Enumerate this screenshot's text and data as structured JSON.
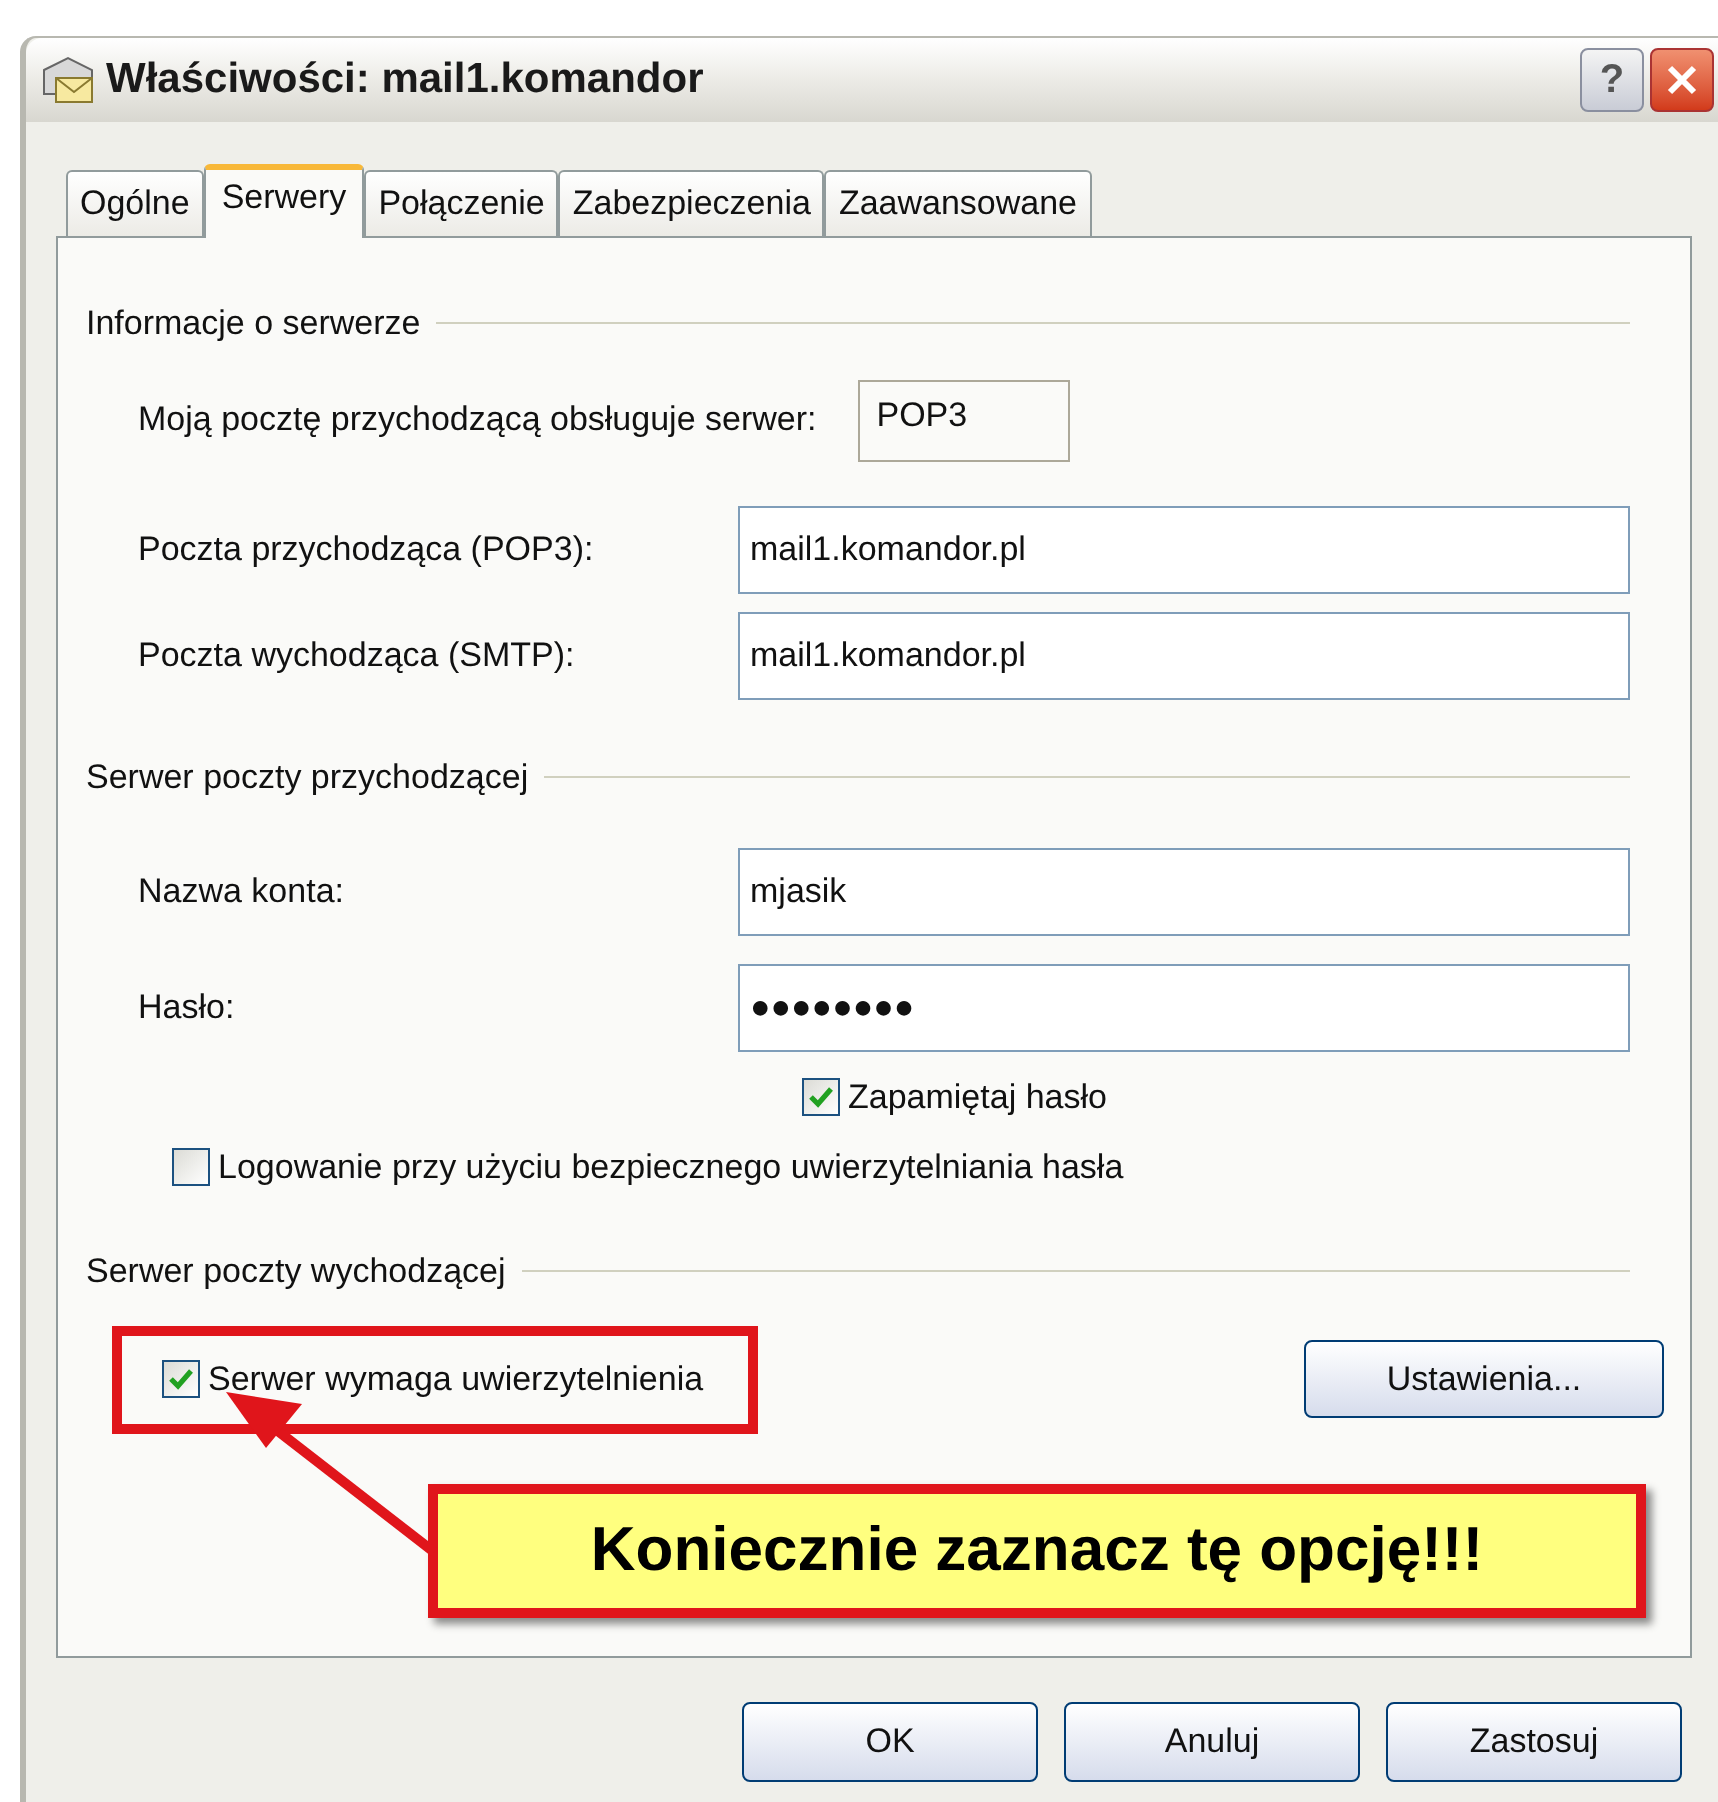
{
  "window": {
    "title": "Właściwości: mail1.komandor",
    "help_label": "?"
  },
  "tabs": [
    {
      "label": "Ogólne",
      "selected": false
    },
    {
      "label": "Serwery",
      "selected": true
    },
    {
      "label": "Połączenie",
      "selected": false
    },
    {
      "label": "Zabezpieczenia",
      "selected": false
    },
    {
      "label": "Zaawansowane",
      "selected": false
    }
  ],
  "server_info": {
    "heading": "Informacje o serwerze",
    "server_type_label": "Moją pocztę przychodzącą obsługuje serwer:",
    "server_type": "POP3",
    "incoming_label": "Poczta przychodząca (POP3):",
    "incoming_value": "mail1.komandor.pl",
    "outgoing_label": "Poczta wychodząca (SMTP):",
    "outgoing_value": "mail1.komandor.pl"
  },
  "incoming_server": {
    "heading": "Serwer poczty przychodzącej",
    "account_label": "Nazwa konta:",
    "account_value": "mjasik",
    "password_label": "Hasło:",
    "password_value": "●●●●●●●●",
    "remember": {
      "label": "Zapamiętaj hasło",
      "checked": true
    },
    "spa": {
      "label": "Logowanie przy użyciu bezpiecznego uwierzytelniania hasła",
      "checked": false
    }
  },
  "outgoing_server": {
    "heading": "Serwer poczty wychodzącej",
    "auth": {
      "label": "Serwer wymaga uwierzytelnienia",
      "checked": true
    },
    "settings_button": "Ustawienia..."
  },
  "callout": {
    "text": "Koniecznie zaznacz tę opcję!!!"
  },
  "buttons": [
    "OK",
    "Anuluj",
    "Zastosuj"
  ]
}
